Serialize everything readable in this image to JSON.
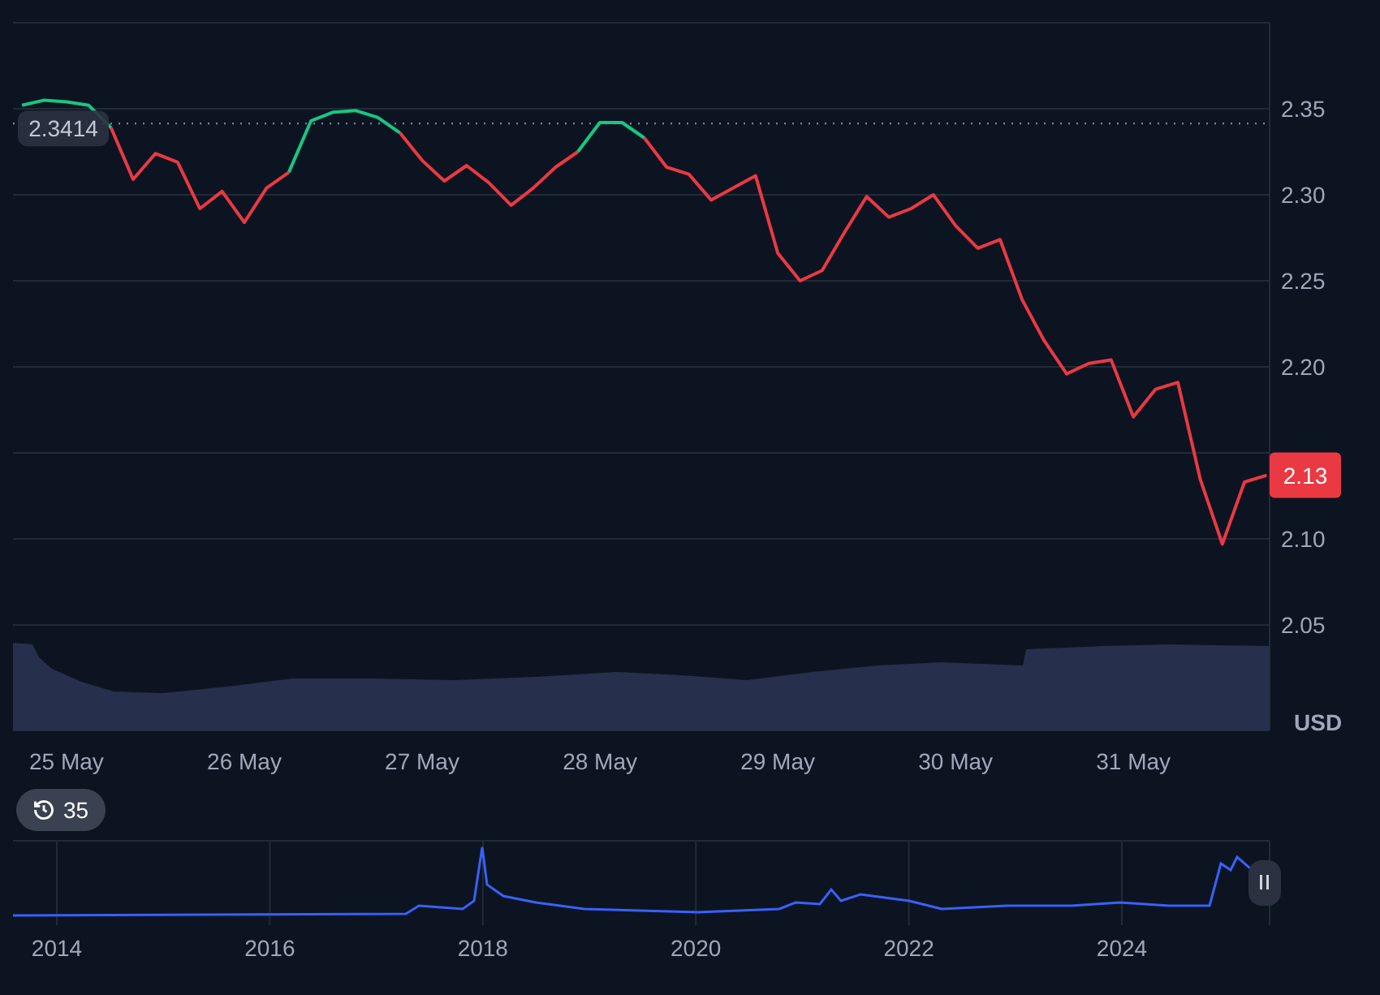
{
  "chart": {
    "chart_data": {
      "type": "line",
      "ylabel": "USD",
      "ylim": [
        1.9887,
        2.4
      ],
      "yticks": [
        {
          "value": 2.05,
          "label": "2.05"
        },
        {
          "value": 2.1,
          "label": "2.10"
        },
        {
          "value": 2.2,
          "label": "2.20"
        },
        {
          "value": 2.25,
          "label": "2.25"
        },
        {
          "value": 2.3,
          "label": "2.30"
        },
        {
          "value": 2.35,
          "label": "2.35"
        }
      ],
      "categories": [
        null,
        null,
        "25 May",
        null,
        null,
        null,
        null,
        null,
        null,
        null,
        "26 May",
        null,
        null,
        null,
        null,
        null,
        null,
        null,
        "27 May",
        null,
        null,
        null,
        null,
        null,
        null,
        null,
        "28 May",
        null,
        null,
        null,
        null,
        null,
        null,
        null,
        "29 May",
        null,
        null,
        null,
        null,
        null,
        null,
        null,
        "30 May",
        null,
        null,
        null,
        null,
        null,
        null,
        null,
        "31 May",
        null,
        null,
        null,
        null,
        null,
        null
      ],
      "grid": true,
      "series": [
        {
          "color": "#16c784",
          "values": [
            2.352,
            2.355,
            2.354,
            2.352,
            2.339,
            null,
            null,
            null,
            null,
            null,
            null,
            null,
            2.313,
            2.343,
            2.348,
            2.349,
            2.345,
            2.336,
            null,
            null,
            null,
            null,
            null,
            null,
            null,
            2.325,
            2.342,
            2.342,
            2.333,
            null,
            null,
            null,
            null,
            null,
            null,
            null,
            null,
            null,
            null,
            null,
            null,
            null,
            null,
            null,
            null,
            null,
            null,
            null,
            null,
            null,
            null,
            null,
            null,
            null,
            null,
            null,
            null
          ]
        },
        {
          "color": "#ea3943",
          "values": [
            null,
            null,
            null,
            null,
            2.339,
            2.309,
            2.324,
            2.319,
            2.292,
            2.302,
            2.284,
            2.304,
            2.313,
            null,
            null,
            null,
            null,
            2.336,
            2.32,
            2.308,
            2.317,
            2.307,
            2.294,
            2.304,
            2.316,
            2.325,
            null,
            null,
            2.333,
            2.316,
            2.312,
            2.297,
            2.304,
            2.311,
            2.266,
            2.25,
            2.256,
            2.278,
            2.299,
            2.287,
            2.292,
            2.3,
            2.282,
            2.269,
            2.274,
            2.239,
            2.215,
            2.196,
            2.202,
            2.204,
            2.171,
            2.187,
            2.191,
            2.135,
            2.097,
            2.133,
            2.137
          ]
        }
      ],
      "ref_lines": [
        {
          "axis": "y",
          "value": 2.3414,
          "label": "2.3414"
        }
      ]
    },
    "current_price": {
      "label": "2.13"
    }
  },
  "navigator": {
    "badge": "35",
    "years": [
      "2014",
      "2016",
      "2018",
      "2020",
      "2022",
      "2024"
    ]
  }
}
